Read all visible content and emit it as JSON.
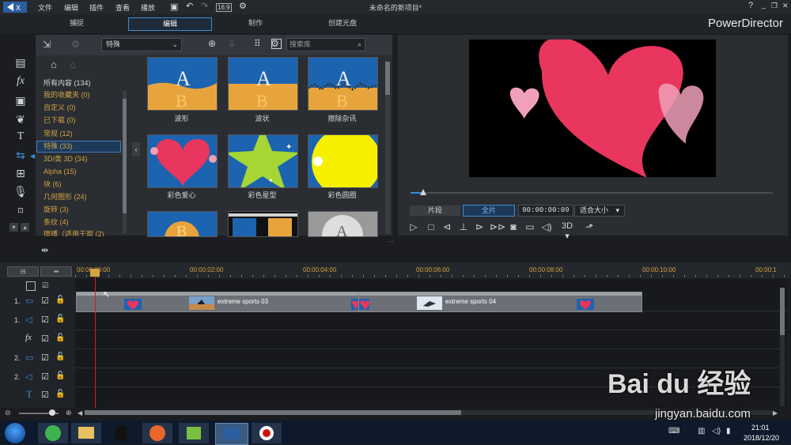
{
  "app": {
    "title": "未命名的新项目*",
    "brand": "PowerDirector"
  },
  "menu": [
    "文件",
    "编辑",
    "插件",
    "查看",
    "播放"
  ],
  "modes": [
    {
      "label": "捕捉"
    },
    {
      "label": "编辑",
      "active": true
    },
    {
      "label": "制作"
    },
    {
      "label": "创建光盘"
    }
  ],
  "library": {
    "category": "特殊",
    "search_placeholder": "搜索库",
    "categories": [
      "所有内容 (134)",
      "我的收藏夹 (0)",
      "自定义 (0)",
      "已下载 (0)",
      "常规 (12)",
      "特殊 (33)",
      "3D/类 3D (34)",
      "Alpha (15)",
      "块 (6)",
      "几何图形 (24)",
      "旋转 (3)",
      "条纹 (4)",
      "擦搏（适用于窗 (2)"
    ],
    "selected_category_index": 5,
    "thumbnails": [
      "波形",
      "波状",
      "擦除杂讯",
      "彩色爱心",
      "彩色星型",
      "彩色圆圈",
      "",
      "",
      ""
    ]
  },
  "preview": {
    "mode_clip": "片段",
    "mode_full": "全片",
    "timecode": "00:00:00:09",
    "fit": "适合大小",
    "threed": "3D"
  },
  "timeline": {
    "ruler": [
      "00:00:00:00",
      "00:00:02:00",
      "00:00:04:00",
      "00:00:06:00",
      "00:00:08:00",
      "00:00:10:00",
      "00:00:1"
    ],
    "tracks": [
      {
        "num": "1.",
        "kind": "video"
      },
      {
        "num": "1.",
        "kind": "audio"
      },
      {
        "num": "",
        "kind": "fx",
        "label": "fx"
      },
      {
        "num": "2.",
        "kind": "video"
      },
      {
        "num": "2.",
        "kind": "audio"
      },
      {
        "num": "",
        "kind": "title",
        "label": "T"
      }
    ],
    "clips": [
      "extreme sports 03",
      "extreme sports 04"
    ]
  },
  "taskbar": {
    "time": "21:01",
    "date": "2018/12/20"
  },
  "watermark": {
    "text": "Bai du 经验",
    "url": "jingyan.baidu.com"
  },
  "colors": {
    "accent": "#3c8bd4",
    "gold": "#d4a444",
    "heart": "#e8365e"
  }
}
